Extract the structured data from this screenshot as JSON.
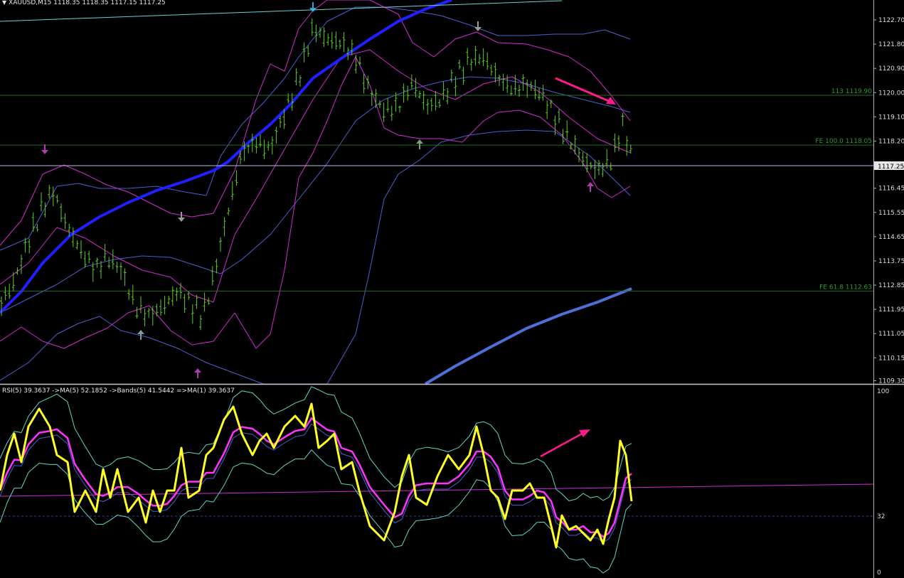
{
  "main_panel": {
    "symbol_header": "XAUUSD,M15  1118.35 1118.35 1117.15 1117.25",
    "price_labels": [
      "1122.70",
      "1121.80",
      "1120.90",
      "1120.00",
      "1119.10",
      "1118.20",
      "1117.25",
      "1116.45",
      "1115.55",
      "1114.65",
      "1113.75",
      "1112.85",
      "1111.95",
      "1111.05",
      "1110.15",
      "1109.30"
    ],
    "current_price": "1117.25",
    "fibo_levels": [
      {
        "label": "113 1119.90",
        "price": 1119.9
      },
      {
        "label": "FE 100.0 1118.05",
        "price": 1118.05
      },
      {
        "label": "FE 61.8 1112.63",
        "price": 1112.63
      }
    ]
  },
  "indicator_panel": {
    "header": "RSI(5) 39.3637  ->MA(5) 52.1852  ->Bands(5) 41.5442  =>MA(1) 39.3637",
    "scale_labels": [
      "100",
      "32",
      "0"
    ]
  },
  "colors": {
    "background": "#000000",
    "bars": "#5dcc2c",
    "ma_fast": "#1f1fff",
    "ma_slow": "#4d6fd6",
    "bands_magenta": "#d22bd2",
    "bands_blue": "#4b5fd0",
    "fibo_line": "#1f6e1f",
    "fibo_text": "#2e9b2e",
    "rsi_line": "#ffff22",
    "rsi_ma": "#ff33ff",
    "rsi_bands": "#5fd6c6",
    "annotation_arrow": "#ff1a8c"
  }
}
